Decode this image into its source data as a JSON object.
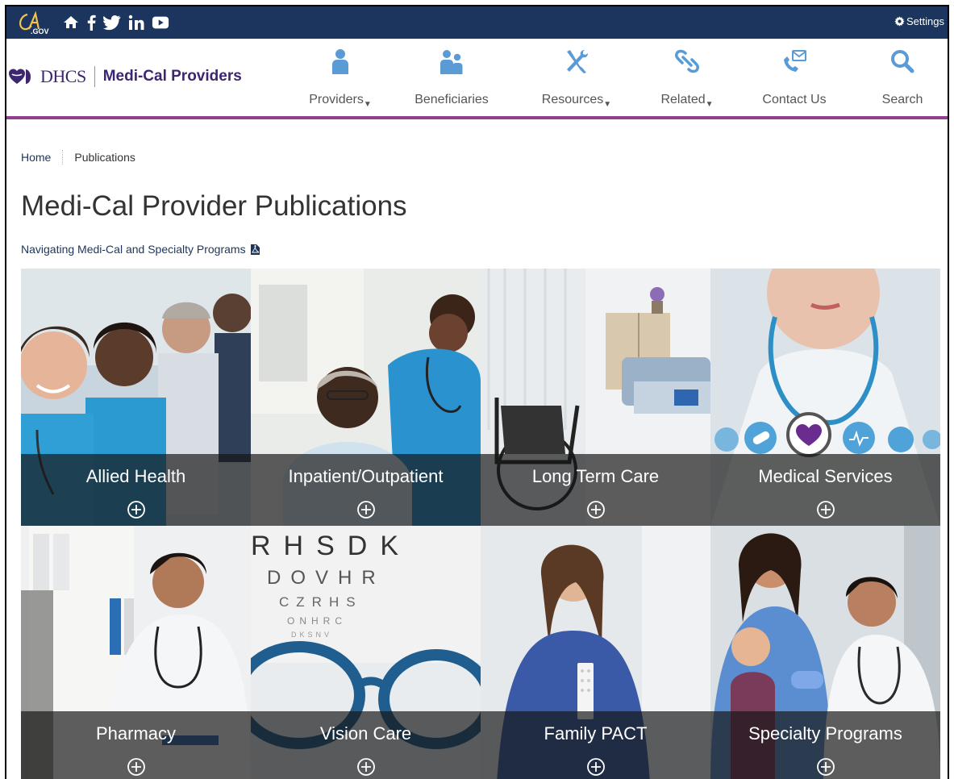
{
  "utility": {
    "logo_text": "CA.GOV",
    "social_icons": [
      "home-icon",
      "facebook-icon",
      "twitter-icon",
      "linkedin-icon",
      "youtube-icon"
    ],
    "settings_label": "Settings"
  },
  "header": {
    "brand_dhcs": "DHCS",
    "brand_title": "Medi-Cal Providers",
    "nav": [
      {
        "label": "Providers",
        "icon": "person-icon",
        "dropdown": true
      },
      {
        "label": "Beneficiaries",
        "icon": "people-icon",
        "dropdown": false
      },
      {
        "label": "Resources",
        "icon": "tools-icon",
        "dropdown": true
      },
      {
        "label": "Related",
        "icon": "link-icon",
        "dropdown": true
      },
      {
        "label": "Contact Us",
        "icon": "phone-mail-icon",
        "dropdown": false
      },
      {
        "label": "Search",
        "icon": "search-icon",
        "dropdown": false
      }
    ]
  },
  "breadcrumb": {
    "home": "Home",
    "current": "Publications"
  },
  "page": {
    "title": "Medi-Cal Provider Publications",
    "guide_link": "Navigating Medi-Cal and Specialty Programs"
  },
  "tiles": [
    {
      "label": "Allied Health"
    },
    {
      "label": "Inpatient/Outpatient"
    },
    {
      "label": "Long Term Care"
    },
    {
      "label": "Medical Services"
    },
    {
      "label": "Pharmacy"
    },
    {
      "label": "Vision Care"
    },
    {
      "label": "Family PACT"
    },
    {
      "label": "Specialty Programs"
    }
  ],
  "colors": {
    "utility_bg": "#1b355e",
    "accent_purple": "#91408f",
    "brand_purple": "#3d2670",
    "icon_blue": "#5b9bd5"
  }
}
